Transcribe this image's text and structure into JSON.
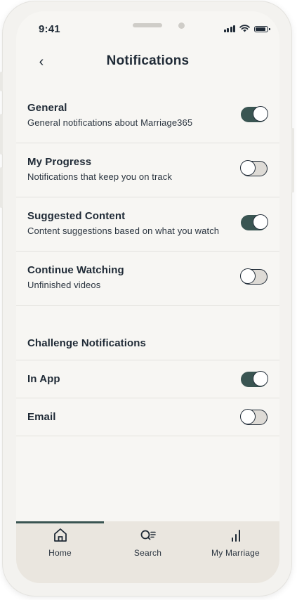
{
  "status_bar": {
    "time": "9:41"
  },
  "header": {
    "title": "Notifications"
  },
  "settings": [
    {
      "label": "General",
      "description": "General notifications about Marriage365",
      "enabled": true
    },
    {
      "label": "My Progress",
      "description": "Notifications that keep you on track",
      "enabled": false
    },
    {
      "label": "Suggested Content",
      "description": "Content suggestions based on what you watch",
      "enabled": true
    },
    {
      "label": "Continue Watching",
      "description": "Unfinished videos",
      "enabled": false
    }
  ],
  "challenge": {
    "heading": "Challenge Notifications",
    "items": [
      {
        "label": "In App",
        "enabled": true
      },
      {
        "label": "Email",
        "enabled": false
      }
    ]
  },
  "tabbar": {
    "tabs": [
      {
        "label": "Home",
        "icon": "home-icon",
        "active": true
      },
      {
        "label": "Search",
        "icon": "search-icon",
        "active": false
      },
      {
        "label": "My Marriage",
        "icon": "bar-chart-icon",
        "active": false
      }
    ]
  },
  "colors": {
    "accent": "#3a5552",
    "background": "#f7f6f3",
    "text": "#1f2a36",
    "tabbar": "#eae6df"
  }
}
